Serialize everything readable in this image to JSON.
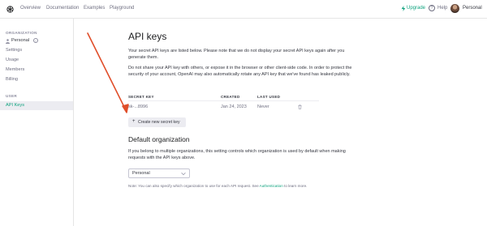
{
  "topbar": {
    "logo_icon": "openai-logo-icon",
    "nav": [
      "Overview",
      "Documentation",
      "Examples",
      "Playground"
    ],
    "upgrade_label": "Upgrade",
    "help_label": "Help",
    "account_label": "Personal"
  },
  "sidebar": {
    "org_heading": "ORGANIZATION",
    "org_name": "Personal",
    "items": [
      "Settings",
      "Usage",
      "Members",
      "Billing"
    ],
    "user_heading": "USER",
    "active_item": "API Keys"
  },
  "main": {
    "title": "API keys",
    "intro": "Your secret API keys are listed below. Please note that we do not display your secret API keys again after you generate them.",
    "warning": "Do not share your API key with others, or expose it in the browser or other client-side code. In order to protect the security of your account, OpenAI may also automatically rotate any API key that we've found has leaked publicly.",
    "table": {
      "headers": [
        "SECRET KEY",
        "CREATED",
        "LAST USED"
      ],
      "rows": [
        {
          "key": "sk-...8996",
          "created": "Jan 24, 2023",
          "last_used": "Never"
        }
      ]
    },
    "create_button": "Create new secret key",
    "default_org_title": "Default organization",
    "default_org_text": "If you belong to multiple organizations, this setting controls which organization is used by default when making requests with the API keys above.",
    "org_select_value": "Personal",
    "note_prefix": "Note: You can also specify which organization to use for each API request. See ",
    "note_link": "Authentication",
    "note_suffix": " to learn more."
  },
  "colors": {
    "accent": "#10a37f",
    "annotation_arrow": "#e04e2a",
    "active_bg": "#ececf1"
  }
}
